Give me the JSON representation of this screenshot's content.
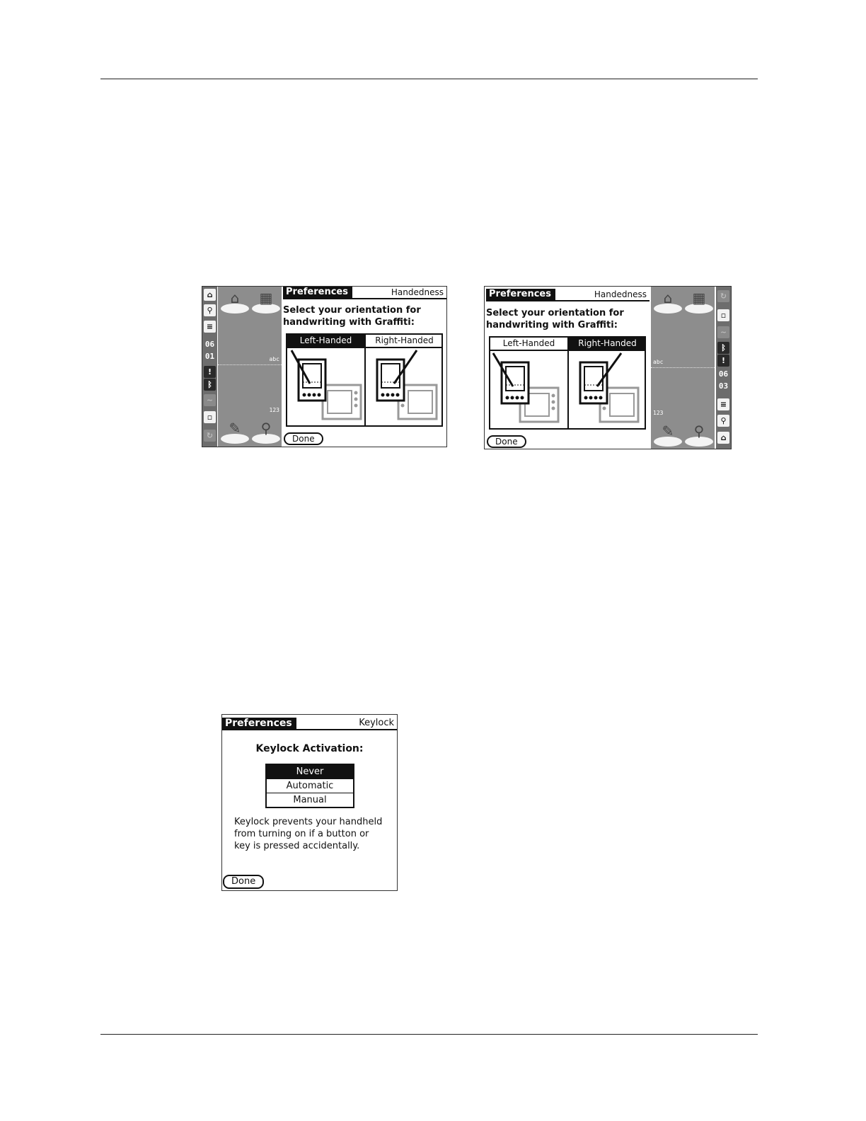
{
  "screens": [
    {
      "app_tab": "Preferences",
      "panel_name": "Handedness",
      "prompt_line1": "Select your orientation for",
      "prompt_line2": "handwriting with Graffiti:",
      "options": [
        "Left-Handed",
        "Right-Handed"
      ],
      "selected": "Left-Handed",
      "done_label": "Done",
      "clock_hour": "06",
      "clock_min": "01",
      "graffiti_alpha": "abc",
      "graffiti_num": "123"
    },
    {
      "app_tab": "Preferences",
      "panel_name": "Handedness",
      "prompt_line1": "Select your orientation for",
      "prompt_line2": "handwriting with Graffiti:",
      "options": [
        "Left-Handed",
        "Right-Handed"
      ],
      "selected": "Right-Handed",
      "done_label": "Done",
      "clock_hour": "06",
      "clock_min": "03",
      "graffiti_alpha": "abc",
      "graffiti_num": "123"
    }
  ],
  "keylock": {
    "app_tab": "Preferences",
    "panel_name": "Keylock",
    "title": "Keylock Activation:",
    "options": [
      "Never",
      "Automatic",
      "Manual"
    ],
    "selected": "Never",
    "desc_line1": "Keylock prevents your handheld",
    "desc_line2": "from turning on if a button or",
    "desc_line3": "key is pressed accidentally.",
    "done_label": "Done"
  },
  "icons": [
    "home-icon",
    "find-icon",
    "menu-icon",
    "alert-icon",
    "bluetooth-icon",
    "graffiti-icon",
    "rotate-icon",
    "applications-icon",
    "calculator-icon",
    "notes-icon",
    "search-icon"
  ]
}
